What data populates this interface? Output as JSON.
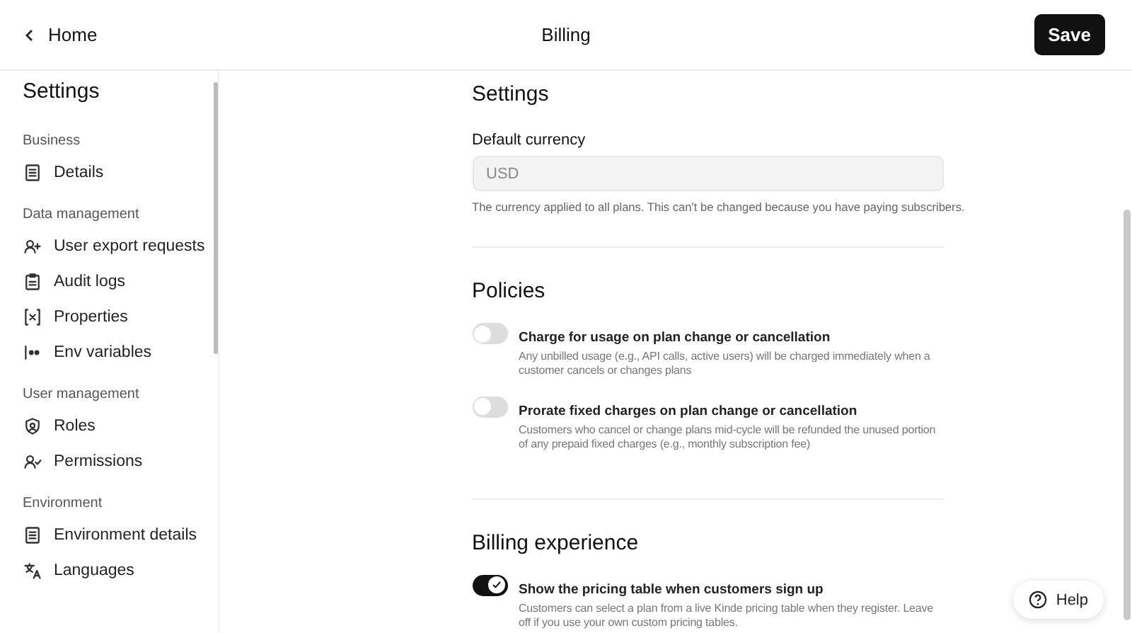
{
  "header": {
    "back_label": "Home",
    "title": "Billing",
    "save_button": "Save"
  },
  "sidebar": {
    "title": "Settings",
    "sections": [
      {
        "heading": "Business",
        "items": [
          {
            "label": "Details"
          }
        ]
      },
      {
        "heading": "Data management",
        "items": [
          {
            "label": "User export requests"
          },
          {
            "label": "Audit logs"
          },
          {
            "label": "Properties"
          },
          {
            "label": "Env variables"
          }
        ]
      },
      {
        "heading": "User management",
        "items": [
          {
            "label": "Roles"
          },
          {
            "label": "Permissions"
          }
        ]
      },
      {
        "heading": "Environment",
        "items": [
          {
            "label": "Environment details"
          },
          {
            "label": "Languages"
          }
        ]
      }
    ]
  },
  "sections": [
    {
      "title": "Settings",
      "field": {
        "label": "Default currency",
        "value": "USD",
        "disabled": true,
        "hint": "The currency applied to all plans. This can't be changed because you have paying subscribers."
      }
    },
    {
      "title": "Policies",
      "toggles": [
        {
          "label": "Charge for usage on plan change or cancellation",
          "description": "Any unbilled usage (e.g., API calls, active users) will be charged immediately when a customer cancels or changes plans",
          "on": false
        },
        {
          "label": "Prorate fixed charges on plan change or cancellation",
          "description": "Customers who cancel or change plans mid-cycle will be refunded the unused portion of any prepaid fixed charges (e.g., monthly subscription fee)",
          "on": false
        }
      ]
    },
    {
      "title": "Billing experience",
      "toggles": [
        {
          "label": "Show the pricing table when customers sign up",
          "description": "Customers can select a plan from a live Kinde pricing table when they register. Leave off if you use your own custom pricing tables.",
          "on": true
        }
      ]
    }
  ],
  "help_button": "Help"
}
